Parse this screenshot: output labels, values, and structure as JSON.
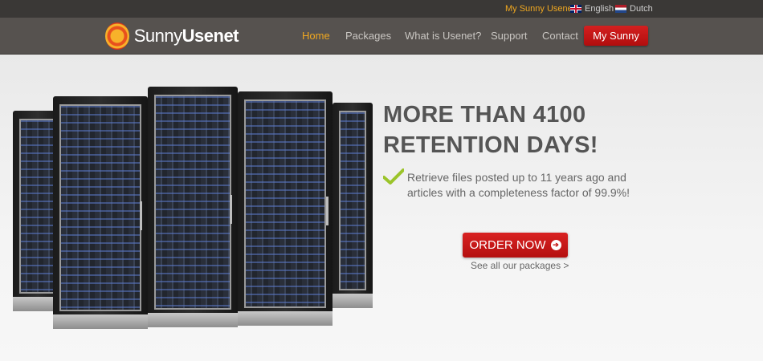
{
  "topbar": {
    "my_sunny_link": "My Sunny Usenet",
    "languages": [
      {
        "label": "English",
        "flag": "uk-flag-icon"
      },
      {
        "label": "Dutch",
        "flag": "nl-flag-icon"
      }
    ]
  },
  "header": {
    "logo": {
      "part1": "Sunny",
      "part2": "Usenet"
    },
    "nav": [
      "Home",
      "Packages",
      "What is Usenet?",
      "Support",
      "Contact"
    ],
    "active_nav": "Home",
    "my_sunny_button": "My Sunny"
  },
  "hero": {
    "headline_line1": "MORE THAN 4100",
    "headline_line2": "RETENTION DAYS!",
    "feature": "Retrieve files posted up to 11 years ago and articles with a completeness factor of 99.9%!",
    "order_button": "ORDER NOW",
    "see_all_link": "See all our packages >"
  },
  "colors": {
    "accent": "#f0a820",
    "button_red": "#c31515",
    "nav_bg": "#56524f",
    "topbar_bg": "#3a3836"
  }
}
